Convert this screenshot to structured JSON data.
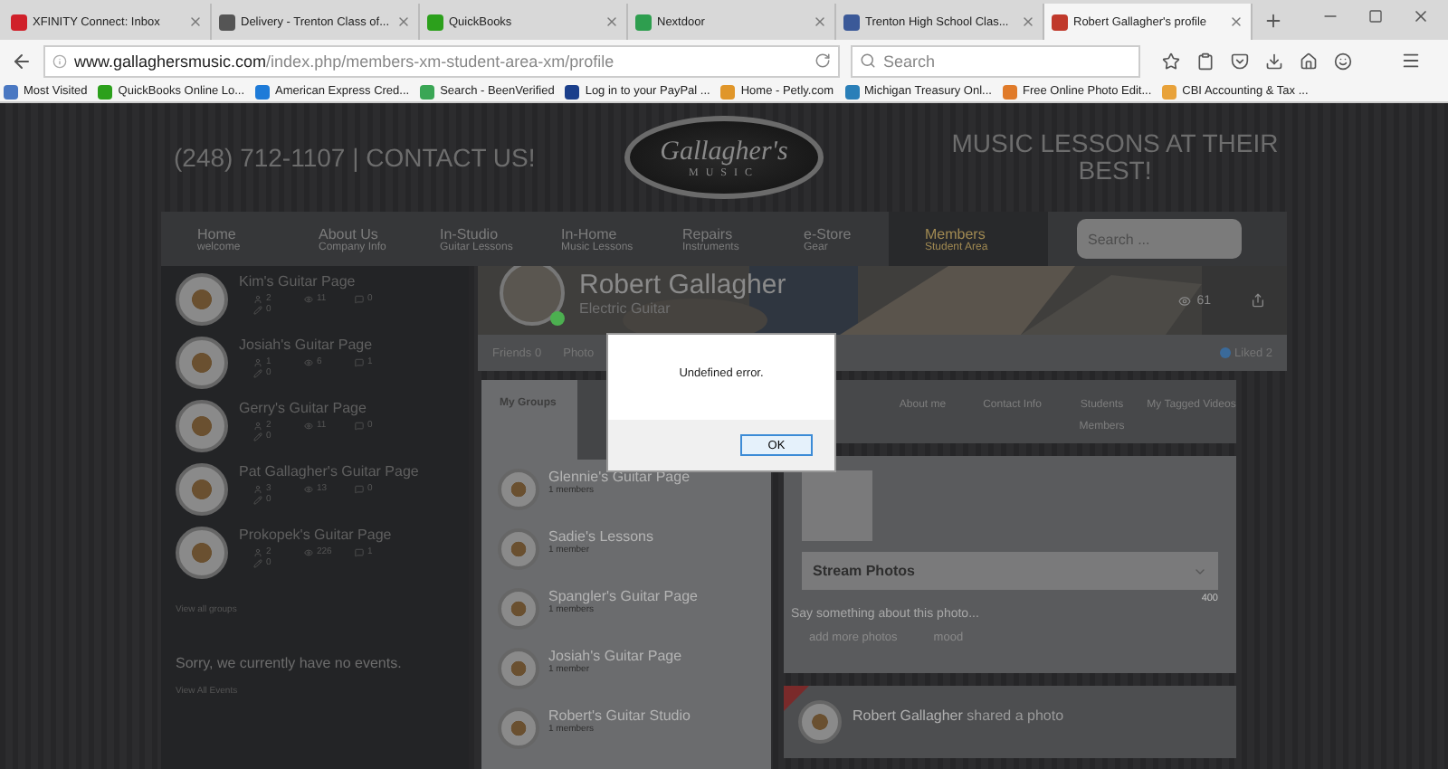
{
  "browser": {
    "tabs": [
      {
        "title": "XFINITY Connect: Inbox",
        "color": "#d0202a",
        "selected": false
      },
      {
        "title": "Delivery - Trenton Class of...",
        "color": "#555555",
        "selected": false
      },
      {
        "title": "QuickBooks",
        "color": "#2ca01c",
        "selected": false
      },
      {
        "title": "Nextdoor",
        "color": "#2e9e4f",
        "selected": false
      },
      {
        "title": "Trenton High School Clas...",
        "color": "#3b5998",
        "selected": false
      },
      {
        "title": "Robert Gallagher's profile",
        "color": "#c0392b",
        "selected": true
      }
    ],
    "url_host": "www.gallaghersmusic.com",
    "url_path": "/index.php/members-xm-student-area-xm/profile",
    "search_placeholder": "Search",
    "bookmarks": [
      {
        "label": "Most Visited",
        "color": "#4a78c2"
      },
      {
        "label": "QuickBooks Online Lo...",
        "color": "#2ca01c"
      },
      {
        "label": "American Express Cred...",
        "color": "#1e7bd8"
      },
      {
        "label": "Search - BeenVerified",
        "color": "#3aa655"
      },
      {
        "label": "Log in to your PayPal ...",
        "color": "#1b3f8b"
      },
      {
        "label": "Home - Petly.com",
        "color": "#e0962a"
      },
      {
        "label": "Michigan Treasury Onl...",
        "color": "#2a7fb8"
      },
      {
        "label": "Free Online Photo Edit...",
        "color": "#e07b2a"
      },
      {
        "label": "CBI Accounting & Tax ...",
        "color": "#e8a23a"
      }
    ]
  },
  "header": {
    "phone": "(248) 712-1107",
    "separator": "|",
    "contact": "CONTACT US!",
    "logo_title": "Gallagher's",
    "logo_sub": "MUSIC",
    "tagline": "MUSIC LESSONS AT THEIR BEST!"
  },
  "nav": {
    "items": [
      {
        "label": "Home",
        "sub": "welcome",
        "selected": false
      },
      {
        "label": "About Us",
        "sub": "Company Info",
        "selected": false
      },
      {
        "label": "In-Studio",
        "sub": "Guitar Lessons",
        "selected": false
      },
      {
        "label": "In-Home",
        "sub": "Music Lessons",
        "selected": false
      },
      {
        "label": "Repairs",
        "sub": "Instruments",
        "selected": false
      },
      {
        "label": "e-Store",
        "sub": "Gear",
        "selected": false
      },
      {
        "label": "Members",
        "sub": "Student Area",
        "selected": true
      }
    ],
    "search_placeholder": "Search ..."
  },
  "sidebar": {
    "groups": [
      {
        "title": "Kim's Guitar Page",
        "stats": [
          "2",
          "11",
          "0",
          "0"
        ]
      },
      {
        "title": "Josiah's Guitar Page",
        "stats": [
          "1",
          "6",
          "1",
          "0"
        ]
      },
      {
        "title": "Gerry's Guitar Page",
        "stats": [
          "2",
          "11",
          "0",
          "0"
        ]
      },
      {
        "title": "Pat Gallagher's Guitar Page",
        "stats": [
          "3",
          "13",
          "0",
          "0"
        ]
      },
      {
        "title": "Prokopek's Guitar Page",
        "stats": [
          "2",
          "226",
          "1",
          "0"
        ]
      }
    ],
    "view_groups": "View all groups",
    "no_events": "Sorry, we currently have no events.",
    "view_events": "View All Events"
  },
  "profile": {
    "name": "Robert Gallagher",
    "instrument": "Electric Guitar",
    "online": true,
    "views": "61",
    "tabs": [
      {
        "label": "Friends 0"
      },
      {
        "label": "Photo"
      }
    ],
    "liked": "Liked 2",
    "group_tabs": [
      {
        "label": "My Groups",
        "selected": true
      }
    ],
    "groups": [
      {
        "title": "Glennie's Guitar Page",
        "members": "1 members"
      },
      {
        "title": "Sadie's Lessons",
        "members": "1 member"
      },
      {
        "title": "Spangler's Guitar Page",
        "members": "1 members"
      },
      {
        "title": "Josiah's Guitar Page",
        "members": "1 member"
      },
      {
        "title": "Robert's Guitar Studio",
        "members": "1 members"
      }
    ],
    "info_tabs": [
      {
        "label": "About me"
      },
      {
        "label": "Contact Info"
      },
      {
        "label": "Students Members"
      },
      {
        "label": "My Tagged Videos"
      }
    ],
    "composer": {
      "album": "Stream Photos",
      "placeholder": "Say something about this photo...",
      "counter": "400",
      "actions": [
        "add more photos",
        "mood"
      ]
    },
    "activity": {
      "author": "Robert Gallagher",
      "action": "shared a photo"
    }
  },
  "dialog": {
    "message": "Undefined error.",
    "button": "OK"
  }
}
